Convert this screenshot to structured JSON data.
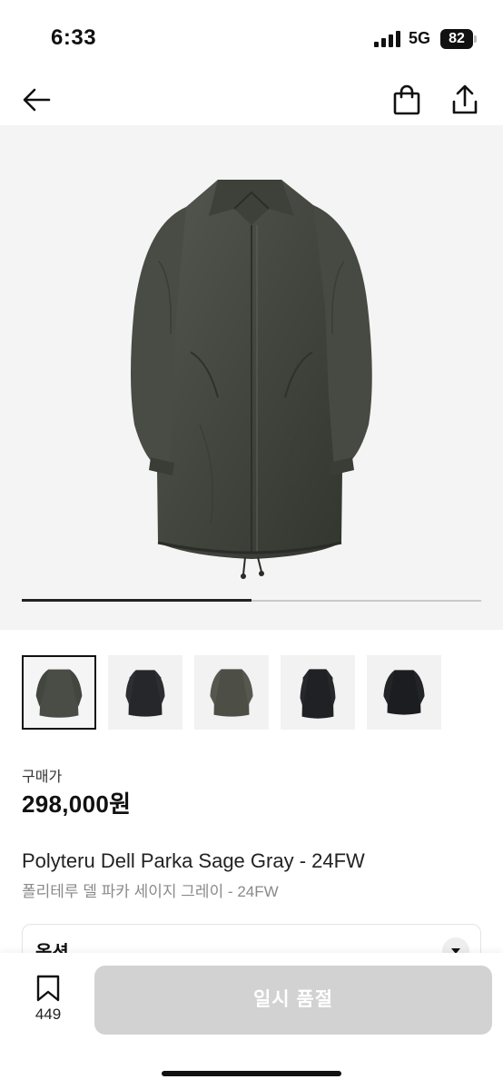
{
  "status_bar": {
    "time": "6:33",
    "network": "5G",
    "battery": "82"
  },
  "nav": {
    "back_icon": "arrow-left-icon",
    "bag_icon": "shopping-bag-icon",
    "share_icon": "share-icon"
  },
  "gallery": {
    "progress_fraction": 0.5,
    "thumbnail_count": 5,
    "selected_index": 0
  },
  "product": {
    "price_label": "구매가",
    "price": "298,000원",
    "title_en": "Polyteru Dell Parka Sage Gray - 24FW",
    "title_ko": "폴리테루 델 파카 세이지 그레이 - 24FW"
  },
  "option": {
    "label": "옵션",
    "chevron_icon": "chevron-down-icon"
  },
  "bottom_bar": {
    "save_icon": "bookmark-icon",
    "save_count": "449",
    "cta_label": "일시 품절"
  },
  "colors": {
    "cta_disabled": "#d2d2d2",
    "hero_background": "#f4f4f4"
  }
}
